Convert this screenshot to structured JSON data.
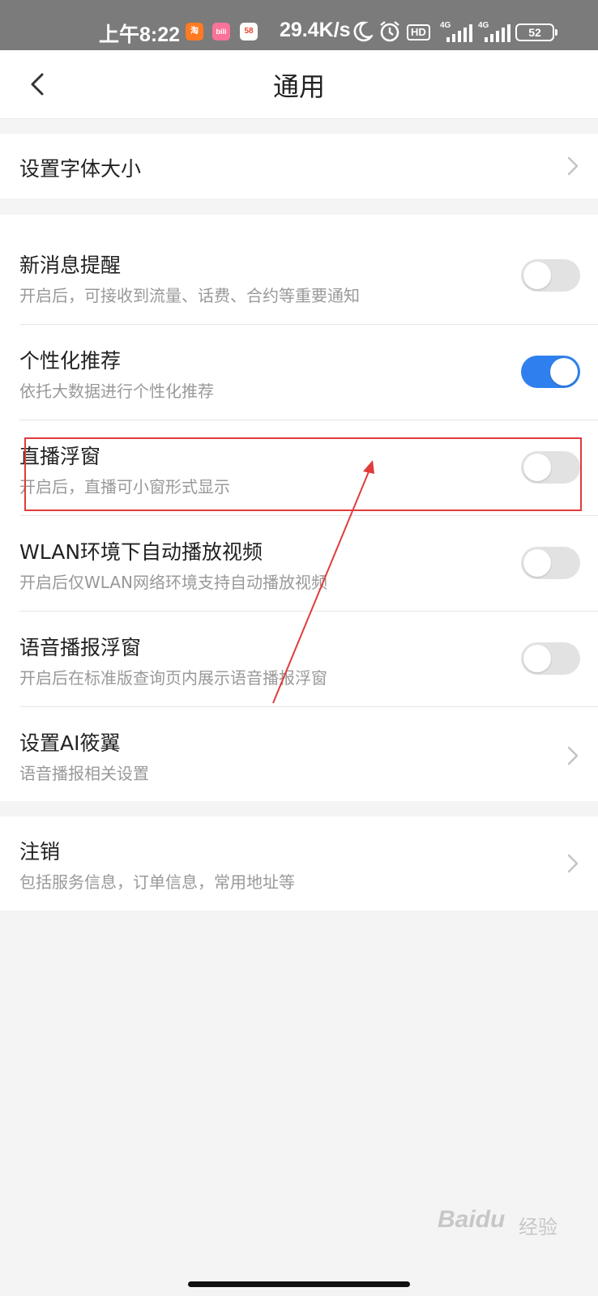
{
  "status_bar": {
    "time": "上午8:22",
    "app_icons": [
      {
        "name": "taobao-icon",
        "label": "淘",
        "color": "#ff7a22"
      },
      {
        "name": "bilibili-icon",
        "label": "bili",
        "color": "#fb7299"
      },
      {
        "name": "58-icon",
        "label": "58",
        "color": "#ffffff"
      }
    ],
    "net_speed": "29.4K/s",
    "hd_label": "HD",
    "signal_1_label": "4G",
    "signal_2_label": "4G",
    "battery_level": "52"
  },
  "header": {
    "title": "通用",
    "back_icon": "back-arrow-icon"
  },
  "sections": {
    "font_size": {
      "title": "设置字体大小"
    },
    "notifications": {
      "title": "新消息提醒",
      "subtitle": "开启后，可接收到流量、话费、合约等重要通知",
      "enabled": false
    },
    "personalized": {
      "title": "个性化推荐",
      "subtitle": "依托大数据进行个性化推荐",
      "enabled": true
    },
    "live_float": {
      "title": "直播浮窗",
      "subtitle": "开启后，直播可小窗形式显示",
      "enabled": false
    },
    "wlan_autoplay": {
      "title": "WLAN环境下自动播放视频",
      "subtitle": "开启后仅WLAN网络环境支持自动播放视频",
      "enabled": false
    },
    "voice_float": {
      "title": "语音播报浮窗",
      "subtitle": "开启后在标准版查询页内展示语音播报浮窗",
      "enabled": false
    },
    "ai_setting": {
      "title": "设置AI筱翼",
      "subtitle": "语音播报相关设置"
    },
    "deregister": {
      "title": "注销",
      "subtitle": "包括服务信息，订单信息，常用地址等"
    }
  },
  "colors": {
    "toggle_on": "#2f80ee",
    "toggle_off": "#e2e2e2",
    "annotation": "#e23b3b"
  },
  "watermark": {
    "brand": "Baidu",
    "suffix": "经验"
  }
}
